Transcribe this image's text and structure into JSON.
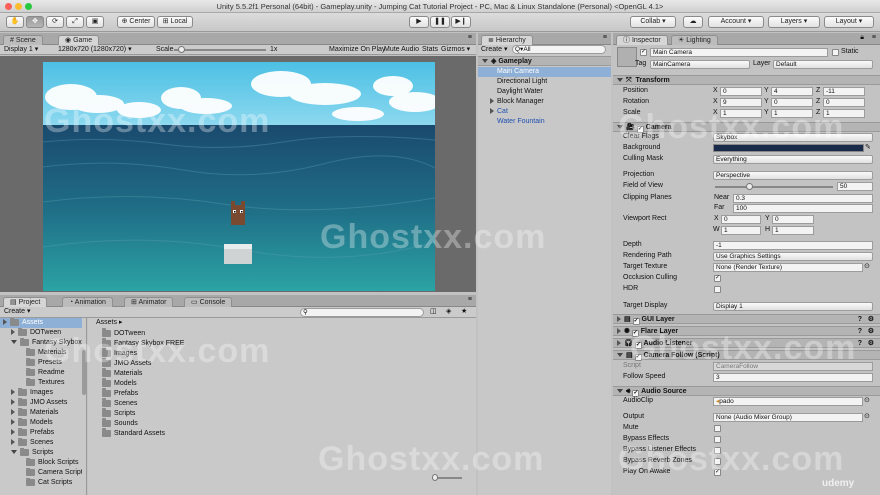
{
  "app": {
    "window_title": "Unity 5.5.2f1 Personal (64bit) - Gameplay.unity - Jumping Cat Tutorial Project - PC, Mac & Linux Standalone (Personal) <OpenGL 4.1>"
  },
  "toolbar": {
    "pivot_label": "Center",
    "space_label": "Local",
    "collab_label": "Collab ▾",
    "account_label": "Account",
    "layers_label": "Layers",
    "layout_label": "Layout"
  },
  "scene_view": {
    "tabs": [
      "Scene",
      "Game"
    ],
    "display": "Display 1",
    "resolution": "1280x720 (1280x720)",
    "scale_label": "Scale",
    "scale_value": "1x",
    "scale_level": 0.05,
    "toggles": [
      "Maximize On Play",
      "Mute Audio",
      "Stats",
      "Gizmos"
    ]
  },
  "hierarchy": {
    "tab": "Hierarchy",
    "create_label": "Create",
    "search_placeholder": "Q▾All",
    "scene": "Gameplay",
    "items": [
      {
        "label": "Main Camera",
        "selected": true
      },
      {
        "label": "Directional Light"
      },
      {
        "label": "Daylight Water"
      },
      {
        "label": "Block Manager",
        "foldable": true
      },
      {
        "label": "Cat",
        "foldable": true,
        "prefab": true
      },
      {
        "label": "Water Fountain",
        "prefab": true
      }
    ]
  },
  "inspector": {
    "tabs": [
      "Inspector",
      "Lighting"
    ],
    "object_name": "Main Camera",
    "static_label": "Static",
    "tag_label": "Tag",
    "tag_value": "MainCamera",
    "layer_label": "Layer",
    "layer_value": "Default",
    "transform": {
      "title": "Transform",
      "rows": [
        {
          "label": "Position",
          "x": "0",
          "y": "4",
          "z": "-11"
        },
        {
          "label": "Rotation",
          "x": "9",
          "y": "0",
          "z": "0"
        },
        {
          "label": "Scale",
          "x": "1",
          "y": "1",
          "z": "1"
        }
      ]
    },
    "camera": {
      "title": "Camera",
      "clear_flags_label": "Clear Flags",
      "clear_flags": "Skybox",
      "background_label": "Background",
      "background_color": "#1a2a4a",
      "culling_mask_label": "Culling Mask",
      "culling_mask": "Everything",
      "projection_label": "Projection",
      "projection": "Perspective",
      "fov_label": "Field of View",
      "fov": "50",
      "fov_level": 0.28,
      "clipping_label": "Clipping Planes",
      "near_label": "Near",
      "near": "0.3",
      "far_label": "Far",
      "far": "100",
      "viewport_label": "Viewport Rect",
      "vx": "0",
      "vy": "0",
      "vw": "1",
      "vh": "1",
      "depth_label": "Depth",
      "depth": "-1",
      "rendering_path_label": "Rendering Path",
      "rendering_path": "Use Graphics Settings",
      "target_texture_label": "Target Texture",
      "target_texture": "None (Render Texture)",
      "occlusion_label": "Occlusion Culling",
      "hdr_label": "HDR",
      "target_display_label": "Target Display",
      "target_display": "Display 1"
    },
    "components": [
      "GUI Layer",
      "Flare Layer",
      "Audio Listener"
    ],
    "camera_follow": {
      "title": "Camera Follow (Script)",
      "script_label": "Script",
      "script_value": "CameraFollow",
      "follow_speed_label": "Follow Speed",
      "follow_speed": "3"
    },
    "audio_source": {
      "title": "Audio Source",
      "clip_label": "AudioClip",
      "clip_value": "pado",
      "output_label": "Output",
      "output_value": "None (Audio Mixer Group)",
      "toggles": [
        {
          "label": "Mute",
          "checked": false
        },
        {
          "label": "Bypass Effects",
          "checked": false
        },
        {
          "label": "Bypass Listener Effects",
          "checked": false
        },
        {
          "label": "Bypass Reverb Zones",
          "checked": false
        },
        {
          "label": "Play On Awake",
          "checked": true
        }
      ]
    }
  },
  "project": {
    "tabs": [
      "Project",
      "Animation",
      "Animator",
      "Console"
    ],
    "create_label": "Create",
    "tree": [
      {
        "label": "Assets",
        "depth": 0,
        "selected": true
      },
      {
        "label": "DOTween",
        "depth": 1
      },
      {
        "label": "Fantasy Skybox F",
        "depth": 1,
        "open": true
      },
      {
        "label": "Materials",
        "depth": 2
      },
      {
        "label": "Presets",
        "depth": 2
      },
      {
        "label": "Readme",
        "depth": 2
      },
      {
        "label": "Textures",
        "depth": 2
      },
      {
        "label": "Images",
        "depth": 1
      },
      {
        "label": "JMO Assets",
        "depth": 1
      },
      {
        "label": "Materials",
        "depth": 1
      },
      {
        "label": "Models",
        "depth": 1
      },
      {
        "label": "Prefabs",
        "depth": 1
      },
      {
        "label": "Scenes",
        "depth": 1
      },
      {
        "label": "Scripts",
        "depth": 1,
        "open": true
      },
      {
        "label": "Block Scripts",
        "depth": 2
      },
      {
        "label": "Camera Script",
        "depth": 2
      },
      {
        "label": "Cat Scripts",
        "depth": 2
      }
    ],
    "breadcrumb": "Assets ▸",
    "folders": [
      "DOTween",
      "Fantasy Skybox FREE",
      "Images",
      "JMO Assets",
      "Materials",
      "Models",
      "Prefabs",
      "Scenes",
      "Scripts",
      "Sounds",
      "Standard Assets"
    ]
  },
  "watermarks": [
    "Ghostxx.com"
  ],
  "udemy": "udemy"
}
